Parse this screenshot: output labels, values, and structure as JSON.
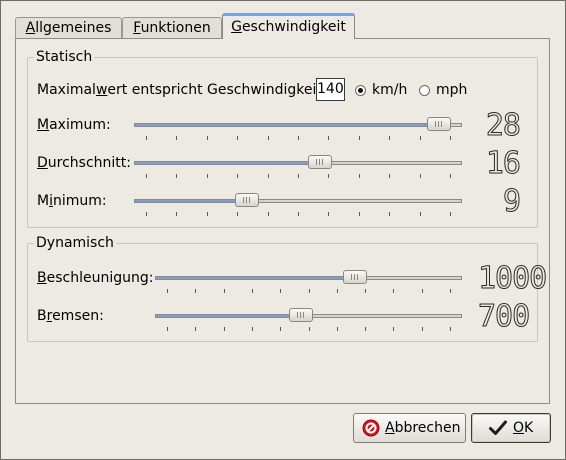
{
  "tabs": [
    {
      "label": "Allgemeines",
      "mnemonic": "A",
      "rest": "llgemeines"
    },
    {
      "label": "Funktionen",
      "mnemonic": "F",
      "rest": "unktionen"
    },
    {
      "label": "Geschwindigkeit",
      "mnemonic": "G",
      "rest": "eschwindigkeit"
    }
  ],
  "statisch": {
    "title": "Statisch",
    "max_label_pre": "Maximal",
    "max_label_mn": "w",
    "max_label_post": "ert entspricht Geschwindigkeit",
    "max_value": "140",
    "unit_kmh": "km/h",
    "unit_mph": "mph",
    "selected_unit": "km/h",
    "sliders": [
      {
        "mn": "M",
        "rest": "aximum:",
        "value": 28,
        "display": "28",
        "fraction": 0.96
      },
      {
        "mn": "D",
        "rest": "urchschnitt:",
        "value": 16,
        "display": "16",
        "fraction": 0.57
      },
      {
        "pre": "M",
        "mn": "i",
        "rest": "nimum:",
        "value": 9,
        "display": "9",
        "fraction": 0.33
      }
    ]
  },
  "dynamisch": {
    "title": "Dynamisch",
    "sliders": [
      {
        "mn": "B",
        "rest": "eschleunigung:",
        "value": 1000,
        "display": "1000",
        "fraction": 0.66
      },
      {
        "pre": "B",
        "mn": "r",
        "rest": "emsen:",
        "value": 700,
        "display": "700",
        "fraction": 0.47
      }
    ]
  },
  "buttons": {
    "cancel": {
      "mn": "A",
      "rest": "bbrechen"
    },
    "ok": {
      "mn": "O",
      "rest": "K"
    }
  },
  "colors": {
    "accent": "#7c9fcf",
    "background": "#ede9e3",
    "cancel_icon": "#d7141c"
  },
  "icons": {
    "cancel": "stop-sign-icon",
    "ok": "checkmark-icon"
  }
}
